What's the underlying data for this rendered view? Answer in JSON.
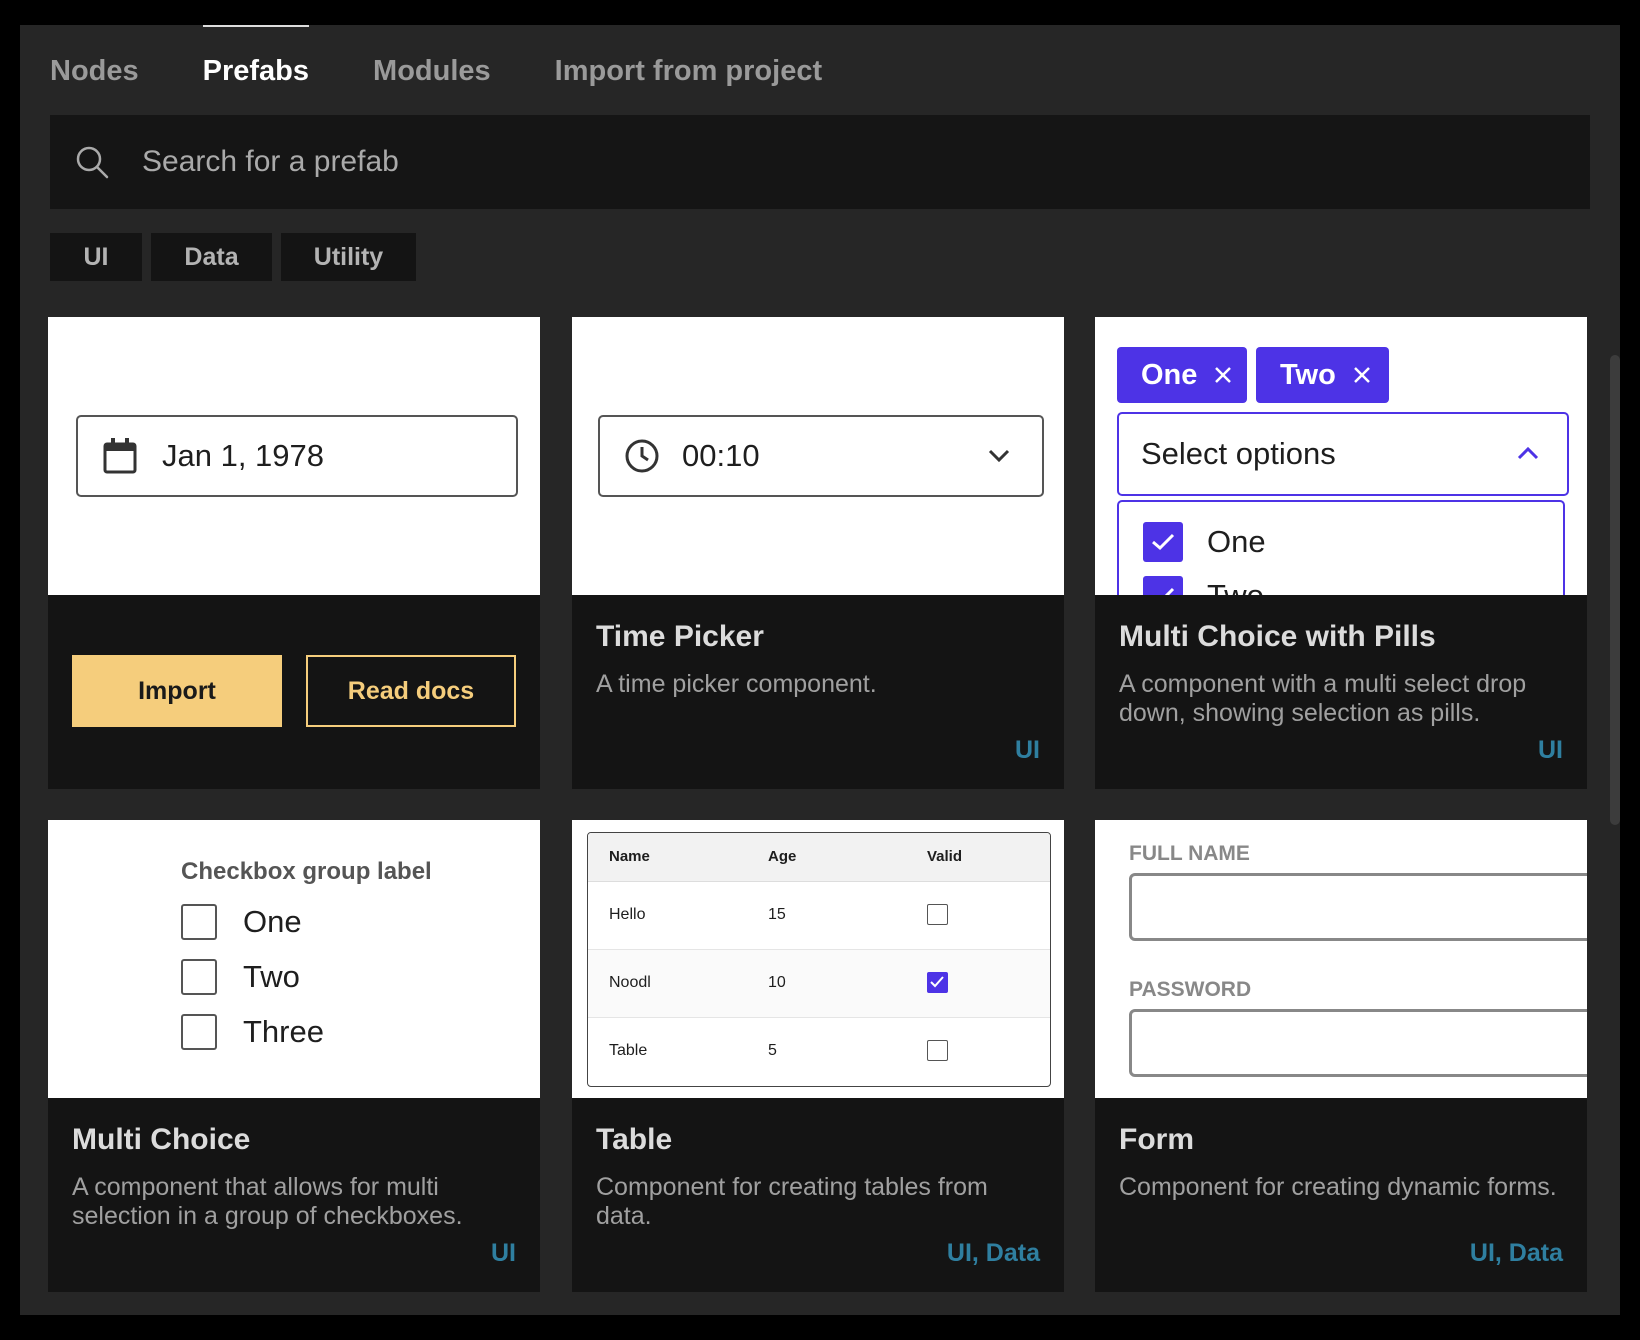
{
  "tabs": [
    {
      "label": "Nodes",
      "active": false
    },
    {
      "label": "Prefabs",
      "active": true
    },
    {
      "label": "Modules",
      "active": false
    },
    {
      "label": "Import from project",
      "active": false
    }
  ],
  "search": {
    "placeholder": "Search for a prefab"
  },
  "filters": [
    "UI",
    "Data",
    "Utility"
  ],
  "cards": {
    "date_picker": {
      "preview_value": "Jan 1, 1978",
      "import_label": "Import",
      "docs_label": "Read docs"
    },
    "time_picker": {
      "preview_value": "00:10",
      "title": "Time Picker",
      "description": "A time picker component.",
      "tags": "UI"
    },
    "multi_choice_pills": {
      "pills": [
        "One",
        "Two"
      ],
      "select_placeholder": "Select options",
      "options": [
        "One",
        "Two"
      ],
      "title": "Multi Choice with Pills",
      "description": "A component with a multi select drop down, showing selection as pills.",
      "tags": "UI"
    },
    "multi_choice": {
      "group_label": "Checkbox group label",
      "options": [
        "One",
        "Two",
        "Three"
      ],
      "title": "Multi Choice",
      "description": "A component that allows for multi selection in a group of checkboxes.",
      "tags": "UI"
    },
    "table": {
      "headers": [
        "Name",
        "Age",
        "Valid"
      ],
      "rows": [
        {
          "name": "Hello",
          "age": "15",
          "valid": false
        },
        {
          "name": "Noodl",
          "age": "10",
          "valid": true
        },
        {
          "name": "Table",
          "age": "5",
          "valid": false
        }
      ],
      "title": "Table",
      "description": "Component for creating tables from data.",
      "tags": "UI, Data"
    },
    "form": {
      "field1_label": "FULL NAME",
      "field2_label": "PASSWORD",
      "title": "Form",
      "description": "Component for creating dynamic forms.",
      "tags": "UI, Data"
    }
  },
  "colors": {
    "accent": "#f5cd7c",
    "purple": "#4d33e6",
    "tag": "#2f7fa0",
    "panel": "#262626",
    "card": "#141414"
  }
}
